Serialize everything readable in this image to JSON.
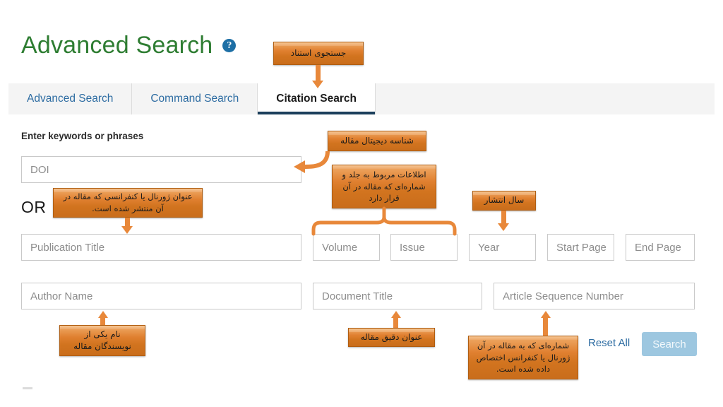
{
  "header": {
    "title": "Advanced Search",
    "help_icon": "question-mark-circle-icon"
  },
  "tabs": [
    {
      "label": "Advanced Search",
      "active": false
    },
    {
      "label": "Command Search",
      "active": false
    },
    {
      "label": "Citation Search",
      "active": true
    }
  ],
  "form": {
    "keywords_label": "Enter keywords or phrases",
    "or_text": "OR",
    "fields": {
      "doi": "DOI",
      "publication_title": "Publication Title",
      "volume": "Volume",
      "issue": "Issue",
      "year": "Year",
      "start_page": "Start Page",
      "end_page": "End Page",
      "author_name": "Author Name",
      "document_title": "Document Title",
      "article_sequence_number": "Article Sequence Number"
    }
  },
  "actions": {
    "reset_all": "Reset All",
    "search": "Search"
  },
  "annotations": {
    "citation_search": "جستجوی استناد",
    "doi": "شناسه دیجیتال مقاله",
    "publication_title": "عنوان ژورنال یا کنفرانسی که مقاله در آن منتشر شده است.",
    "volume_issue": "اطلاعات مربوط به جلد و شماره‌ای که مقاله در آن قرار دارد",
    "year": "سال انتشار",
    "author_name": "نام یکی از نویسندگان مقاله",
    "document_title": "عنوان دقیق مقاله",
    "article_sequence_number": "شماره‌ای که به مقاله در آن ژورنال یا کنفرانس اختصاص داده شده است."
  },
  "colors": {
    "title_green": "#2e7d32",
    "tab_blue": "#2d6ca2",
    "active_tab_underline": "#1c3f5c",
    "callout_orange": "#e08030",
    "search_button": "#9dc7e0",
    "help_icon_blue": "#1d6fa5"
  }
}
